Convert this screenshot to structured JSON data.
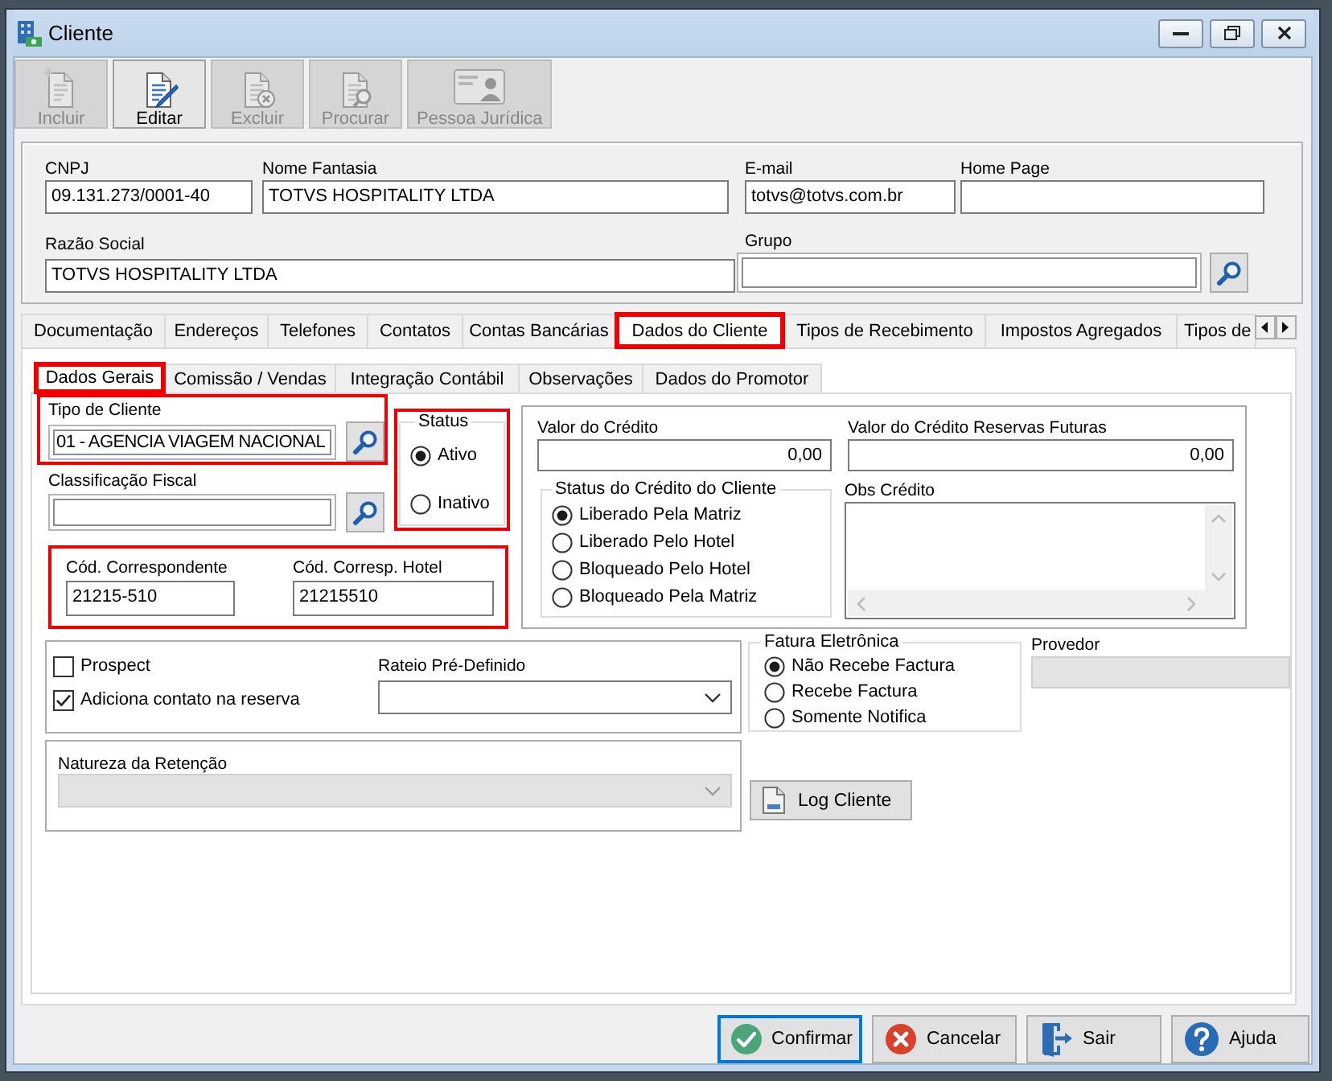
{
  "window": {
    "title": "Cliente"
  },
  "toolbar": [
    {
      "label": "Incluir",
      "disabled": true
    },
    {
      "label": "Editar",
      "disabled": false
    },
    {
      "label": "Excluir",
      "disabled": true
    },
    {
      "label": "Procurar",
      "disabled": true
    },
    {
      "label": "Pessoa Jurídica",
      "disabled": true
    }
  ],
  "header": {
    "cnpj": {
      "label": "CNPJ",
      "value": "09.131.273/0001-40"
    },
    "nome_fantasia": {
      "label": "Nome Fantasia",
      "value": "TOTVS HOSPITALITY LTDA"
    },
    "email": {
      "label": "E-mail",
      "value": "totvs@totvs.com.br"
    },
    "home_page": {
      "label": "Home Page"
    },
    "razao_social": {
      "label": "Razão Social",
      "value": "TOTVS HOSPITALITY LTDA"
    },
    "grupo": {
      "label": "Grupo"
    }
  },
  "tabs": [
    {
      "label": "Documentação",
      "selected": false,
      "highlighted": false
    },
    {
      "label": "Endereços",
      "selected": false,
      "highlighted": false
    },
    {
      "label": "Telefones",
      "selected": false,
      "highlighted": false
    },
    {
      "label": "Contatos",
      "selected": false,
      "highlighted": false
    },
    {
      "label": "Contas Bancárias",
      "selected": false,
      "highlighted": false
    },
    {
      "label": "Dados do Cliente",
      "selected": true,
      "highlighted": true
    },
    {
      "label": "Tipos de Recebimento",
      "selected": false,
      "highlighted": false
    },
    {
      "label": "Impostos Agregados",
      "selected": false,
      "highlighted": false
    },
    {
      "label": "Tipos de",
      "selected": false,
      "highlighted": false
    }
  ],
  "subtabs": [
    {
      "label": "Dados Gerais",
      "selected": true,
      "highlighted": true
    },
    {
      "label": "Comissão / Vendas",
      "selected": false,
      "highlighted": false
    },
    {
      "label": "Integração Contábil",
      "selected": false,
      "highlighted": false
    },
    {
      "label": "Observações",
      "selected": false,
      "highlighted": false
    },
    {
      "label": "Dados do Promotor",
      "selected": false,
      "highlighted": false
    }
  ],
  "dados_gerais": {
    "tipo_cliente": {
      "label": "Tipo de Cliente",
      "value": "01 - AGENCIA VIAGEM NACIONAL",
      "highlighted": true
    },
    "classificacao_fiscal": {
      "label": "Classificação Fiscal"
    },
    "status": {
      "legend": "Status",
      "highlighted": true,
      "options": [
        {
          "label": "Ativo",
          "selected": true
        },
        {
          "label": "Inativo",
          "selected": false
        }
      ]
    },
    "codigos": {
      "highlighted": true,
      "fields": [
        {
          "label": "Cód. Correspondente",
          "value": "21215-510"
        },
        {
          "label": "Cód. Corresp. Hotel",
          "value": "21215510"
        }
      ]
    },
    "credito": {
      "valor": {
        "label": "Valor do Crédito",
        "value": "0,00"
      },
      "valor_futuras": {
        "label": "Valor do Crédito Reservas Futuras",
        "value": "0,00"
      },
      "status_credito": {
        "legend": "Status do Crédito do Cliente",
        "options": [
          {
            "label": "Liberado Pela Matriz",
            "selected": true
          },
          {
            "label": "Liberado Pelo Hotel",
            "selected": false
          },
          {
            "label": "Bloqueado Pelo Hotel",
            "selected": false
          },
          {
            "label": "Bloqueado Pela Matriz",
            "selected": false
          }
        ]
      },
      "obs": {
        "label": "Obs Crédito"
      }
    },
    "opcoes": [
      {
        "label": "Prospect",
        "checked": false
      },
      {
        "label": "Adiciona contato na reserva",
        "checked": true
      }
    ],
    "rateio": {
      "label": "Rateio Pré-Definido"
    },
    "fatura": {
      "legend": "Fatura Eletrônica",
      "options": [
        {
          "label": "Não Recebe Factura",
          "selected": true
        },
        {
          "label": "Recebe Factura",
          "selected": false
        },
        {
          "label": "Somente Notifica",
          "selected": false
        }
      ]
    },
    "provedor": {
      "label": "Provedor",
      "disabled": true
    },
    "natureza": {
      "label": "Natureza da Retenção",
      "disabled": true
    },
    "log_button": "Log Cliente"
  },
  "footer_buttons": [
    {
      "label": "Confirmar",
      "focused": true
    },
    {
      "label": "Cancelar",
      "focused": false
    },
    {
      "label": "Sair",
      "focused": false
    },
    {
      "label": "Ajuda",
      "focused": false
    }
  ]
}
